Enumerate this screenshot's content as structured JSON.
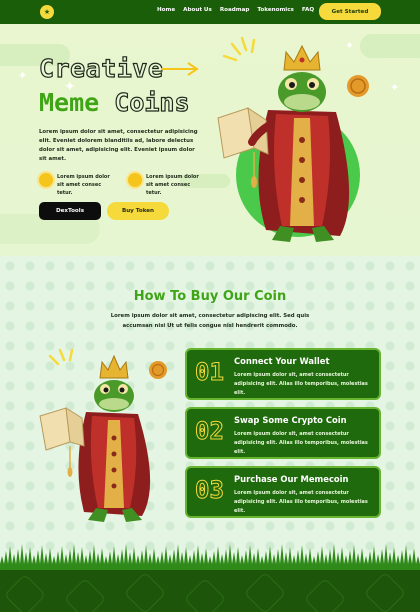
{
  "header": {
    "logo_glyph": "★",
    "nav": [
      "Home",
      "About Us",
      "Roadmap",
      "Tokenomics",
      "FAQ"
    ],
    "cta_label": "Get Started"
  },
  "hero": {
    "title_line1": "Creative",
    "title_line2a": "Meme",
    "title_line2b": "Coins",
    "description": "Lorem ipsum dolor sit amet, consectetur adipisicing elit. Eveniet dolorem blanditiis ad, labore delectus dolor sit amet, adipisicing elit. Eveniet ipsum dolor sit amet.",
    "features": [
      {
        "text": "Lorem ipsum dolor sit amet consec tetur."
      },
      {
        "text": "Lorem ipsum dolor sit amet consec tetur."
      }
    ],
    "btn_primary": "DexTools",
    "btn_secondary": "Buy Token"
  },
  "how_to_buy": {
    "title": "How To Buy Our Coin",
    "description": "Lorem ipsum dolor sit amet, consectetur adipiscing elit. Sed quis accumsan nisi Ut ut felis congue nisl hendrerit commodo.",
    "steps": [
      {
        "num": "01",
        "title": "Connect Your Wallet",
        "desc": "Lorem ipsum dolor sit, amet consectetur adipisicing elit. Alias illo temporibus, molestias elit."
      },
      {
        "num": "02",
        "title": "Swap Some Crypto Coin",
        "desc": "Lorem ipsum dolor sit, amet consectetur adipisicing elit. Alias illo temporibus, molestias elit."
      },
      {
        "num": "03",
        "title": "Purchase Our Memecoin",
        "desc": "Lorem ipsum dolor sit, amet consectetur adipisicing elit. Alias illo temporibus, molestias elit."
      }
    ]
  },
  "colors": {
    "brand_green": "#3fa517",
    "dark_green": "#1b5e0a",
    "accent_yellow": "#f6d93b"
  },
  "icons": [
    "coin-logo-icon",
    "arrow-right-icon",
    "sun-icon",
    "sparkle-icon",
    "frog-king-illustration",
    "gold-coin-icon"
  ]
}
